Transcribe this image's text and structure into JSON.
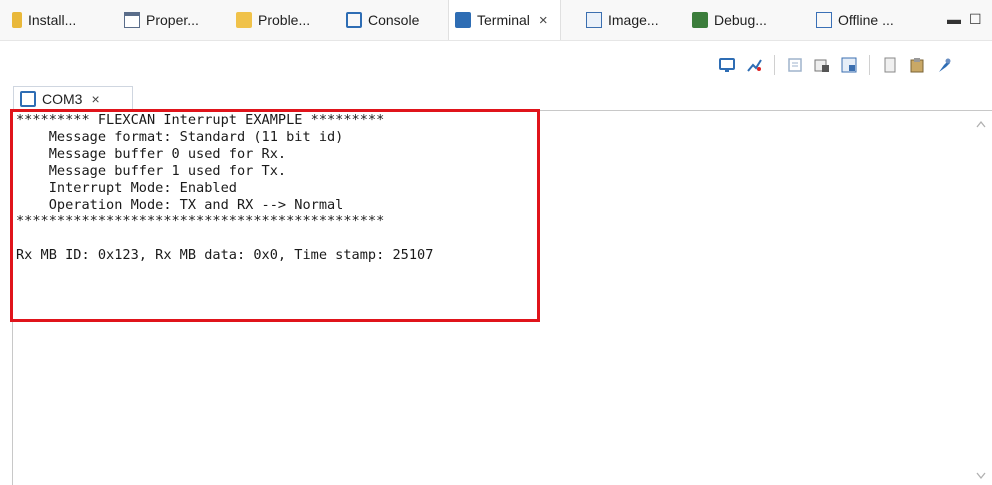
{
  "view_tabs": [
    {
      "label": "Install...",
      "icon": "install-icon"
    },
    {
      "label": "Proper...",
      "icon": "properties-icon"
    },
    {
      "label": "Proble...",
      "icon": "problems-icon"
    },
    {
      "label": "Console",
      "icon": "console-icon"
    },
    {
      "label": "Terminal",
      "icon": "terminal-icon",
      "active": true,
      "close": "×"
    },
    {
      "label": "Image...",
      "icon": "image-icon"
    },
    {
      "label": "Debug...",
      "icon": "debug-icon"
    },
    {
      "label": "Offline ...",
      "icon": "offline-icon"
    }
  ],
  "window_controls": {
    "minimize": "▬",
    "maximize": "☐"
  },
  "toolbar_icons": [
    "new-terminal-icon",
    "connect-icon",
    "disconnect-icon",
    "settings-icon",
    "scroll-lock-icon",
    "copy-icon",
    "paste-icon",
    "pin-icon"
  ],
  "session_tab": {
    "label": "COM3",
    "close": "×",
    "icon": "console-icon"
  },
  "terminal": {
    "lines": [
      "********* FLEXCAN Interrupt EXAMPLE *********",
      "    Message format: Standard (11 bit id)",
      "    Message buffer 0 used for Rx.",
      "    Message buffer 1 used for Tx.",
      "    Interrupt Mode: Enabled",
      "    Operation Mode: TX and RX --> Normal",
      "*********************************************",
      "",
      "Rx MB ID: 0x123, Rx MB data: 0x0, Time stamp: 25107"
    ]
  },
  "colors": {
    "highlight": "#e0141b",
    "accent": "#2e6db4"
  }
}
